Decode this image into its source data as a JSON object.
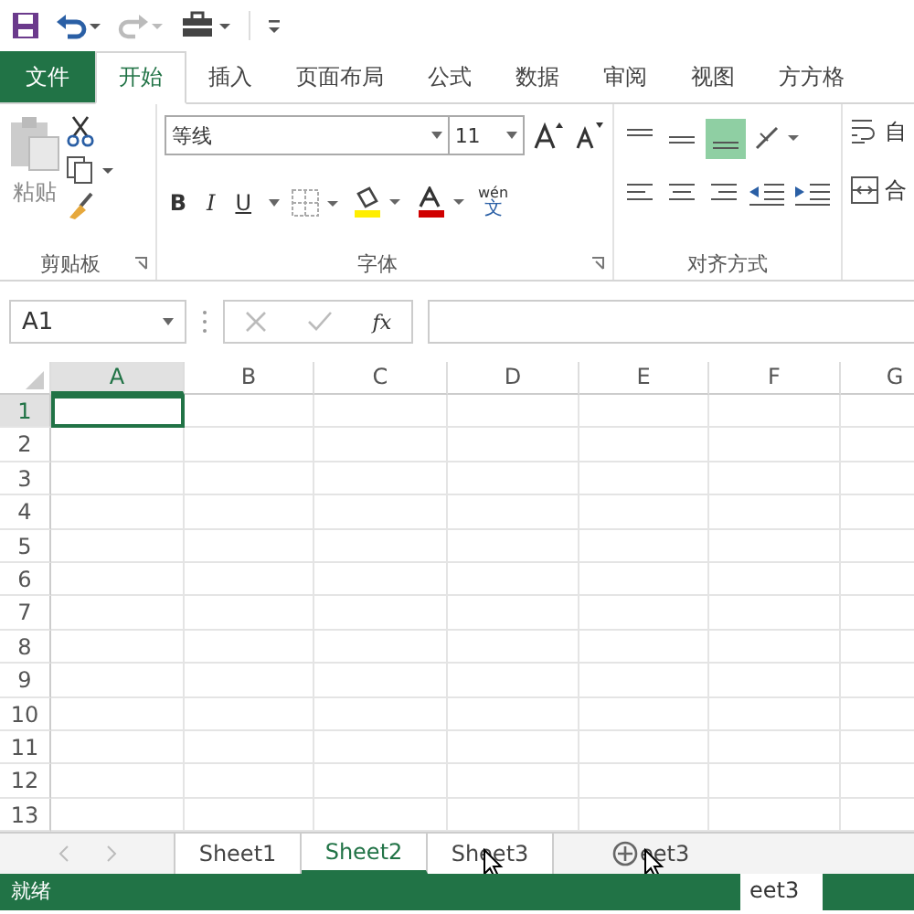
{
  "tabs": [
    {
      "label": "文件",
      "kind": "file",
      "selected": false
    },
    {
      "label": "开始",
      "kind": "tab",
      "selected": true
    },
    {
      "label": "插入",
      "kind": "tab",
      "selected": false
    },
    {
      "label": "页面布局",
      "kind": "tab",
      "selected": false
    },
    {
      "label": "公式",
      "kind": "tab",
      "selected": false
    },
    {
      "label": "数据",
      "kind": "tab",
      "selected": false
    },
    {
      "label": "审阅",
      "kind": "tab",
      "selected": false
    },
    {
      "label": "视图",
      "kind": "tab",
      "selected": false
    },
    {
      "label": "方方格",
      "kind": "tab",
      "selected": false
    }
  ],
  "ribbon": {
    "paste_label": "粘贴",
    "font_name": "等线",
    "bold": "B",
    "italic": "I",
    "underline": "U",
    "font_size": "11",
    "phonetic_label": "wén",
    "phonetic_char": "文",
    "clipboard_group": "剪贴板",
    "font_group": "字体",
    "align_group": "对齐方式",
    "wrap_label": "自",
    "merge_label": "合"
  },
  "formula_bar": {
    "name_box": "A1",
    "fx": "fx"
  },
  "columns": [
    {
      "label": "A",
      "selected": true
    },
    {
      "label": "B",
      "selected": false
    },
    {
      "label": "C",
      "selected": false
    },
    {
      "label": "D",
      "selected": false
    },
    {
      "label": "E",
      "selected": false
    },
    {
      "label": "F",
      "selected": false
    },
    {
      "label": "G",
      "selected": false
    }
  ],
  "rows": [
    {
      "label": "1",
      "selected": true
    },
    {
      "label": "2",
      "selected": false
    },
    {
      "label": "3",
      "selected": false
    },
    {
      "label": "4",
      "selected": false
    },
    {
      "label": "5",
      "selected": false
    },
    {
      "label": "6",
      "selected": false
    },
    {
      "label": "7",
      "selected": false
    },
    {
      "label": "8",
      "selected": false
    },
    {
      "label": "9",
      "selected": false
    },
    {
      "label": "10",
      "selected": false
    },
    {
      "label": "11",
      "selected": false
    },
    {
      "label": "12",
      "selected": false
    },
    {
      "label": "13",
      "selected": false
    }
  ],
  "sheets": [
    {
      "label": "Sheet1",
      "selected": false
    },
    {
      "label": "Sheet2",
      "selected": true
    },
    {
      "label": "Sheet3",
      "selected": false
    }
  ],
  "drag_ghost": "eet3",
  "drag_ghost_bottom": "eet3",
  "status_bar": {
    "text": "就绪"
  }
}
